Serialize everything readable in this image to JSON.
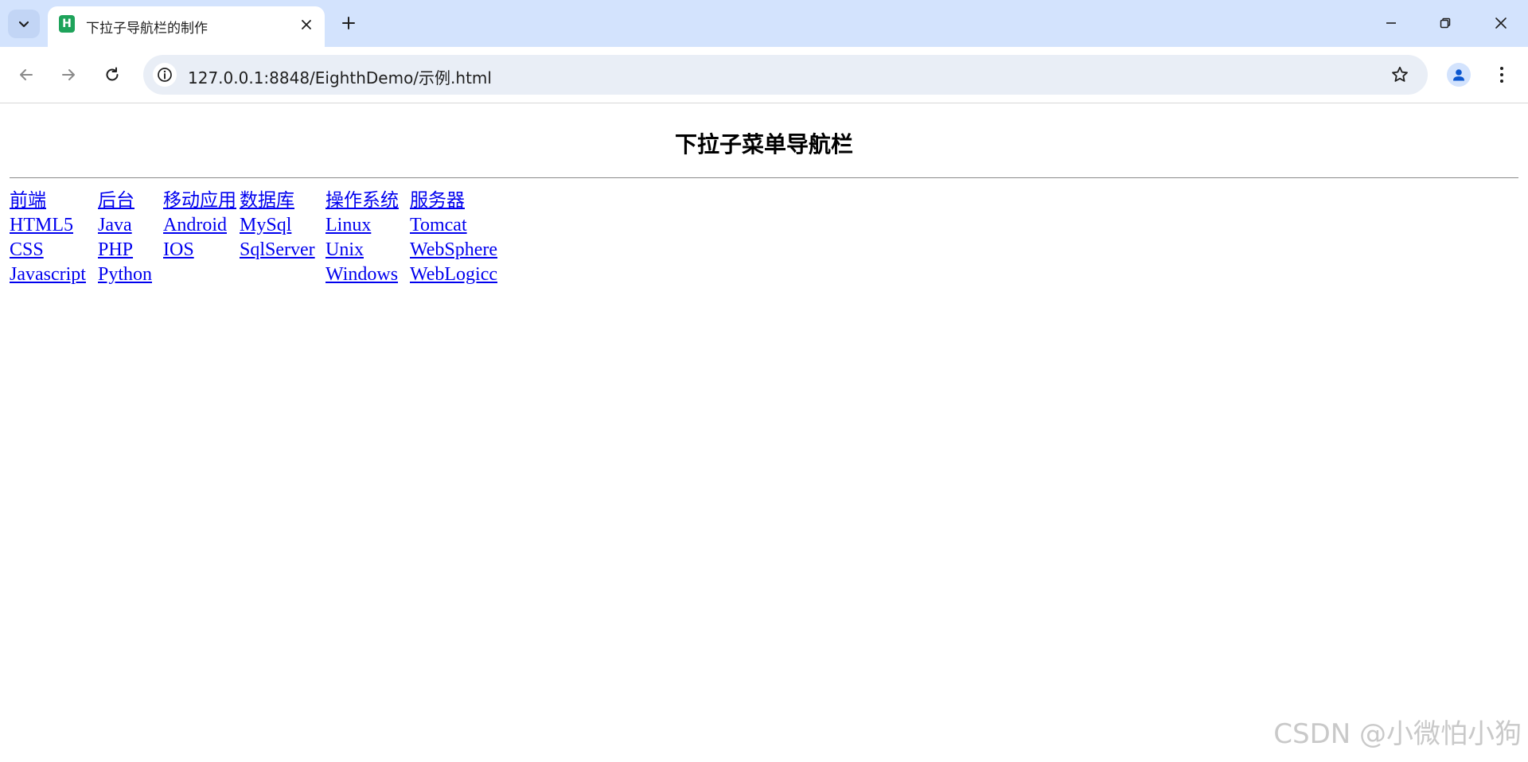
{
  "browser": {
    "tab_title": "下拉子导航栏的制作",
    "tab_favicon_letter": "H",
    "url": "127.0.0.1:8848/EighthDemo/示例.html"
  },
  "page": {
    "title": "下拉子菜单导航栏",
    "watermark": "CSDN @小微怕小狗"
  },
  "menu": [
    {
      "header": "前端",
      "width": 111,
      "items": [
        "HTML5",
        "CSS",
        "Javascript"
      ]
    },
    {
      "header": "后台",
      "width": 82,
      "items": [
        "Java",
        "PHP",
        "Python"
      ]
    },
    {
      "header": "移动应用",
      "width": 96,
      "items": [
        "Android",
        "IOS"
      ]
    },
    {
      "header": "数据库",
      "width": 108,
      "items": [
        "MySql",
        "SqlServer"
      ]
    },
    {
      "header": "操作系统",
      "width": 106,
      "items": [
        "Linux",
        "Unix",
        "Windows"
      ]
    },
    {
      "header": "服务器",
      "width": 140,
      "items": [
        "Tomcat",
        "WebSphere",
        "WebLogicc"
      ]
    }
  ]
}
